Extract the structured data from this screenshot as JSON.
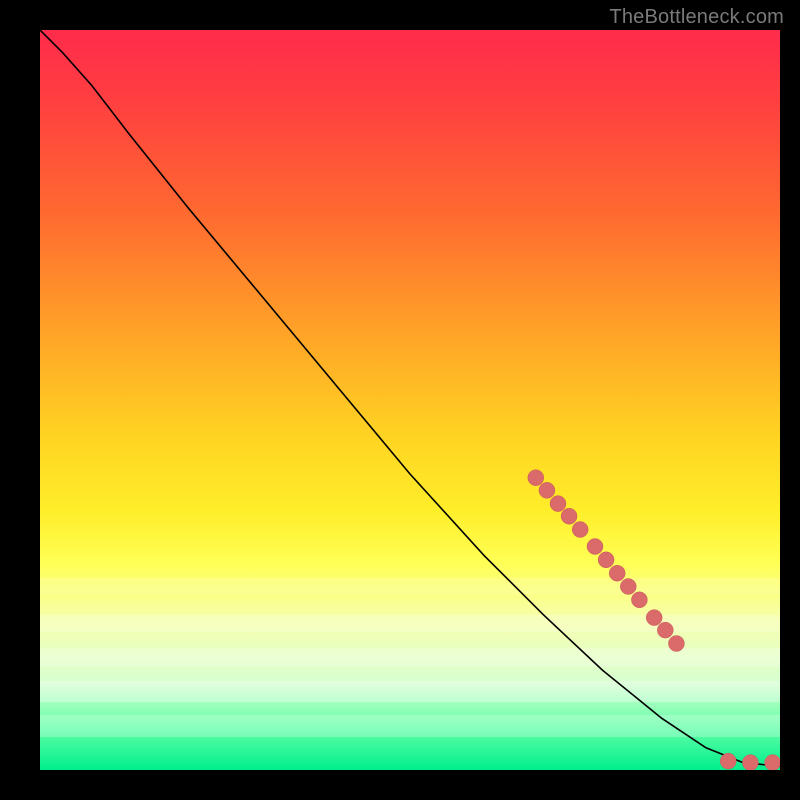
{
  "watermark": "TheBottleneck.com",
  "chart_data": {
    "type": "line",
    "title": "",
    "xlabel": "",
    "ylabel": "",
    "xlim": [
      0,
      100
    ],
    "ylim": [
      0,
      100
    ],
    "curve": [
      {
        "x": 0,
        "y": 100
      },
      {
        "x": 3,
        "y": 97
      },
      {
        "x": 7,
        "y": 92.5
      },
      {
        "x": 12,
        "y": 86
      },
      {
        "x": 20,
        "y": 76
      },
      {
        "x": 30,
        "y": 64
      },
      {
        "x": 40,
        "y": 52
      },
      {
        "x": 50,
        "y": 40
      },
      {
        "x": 60,
        "y": 29
      },
      {
        "x": 68,
        "y": 21
      },
      {
        "x": 76,
        "y": 13.5
      },
      {
        "x": 84,
        "y": 7
      },
      {
        "x": 90,
        "y": 3
      },
      {
        "x": 95,
        "y": 1
      },
      {
        "x": 100,
        "y": 0.5
      }
    ],
    "series": [
      {
        "name": "markers",
        "color": "#db6b6b",
        "points": [
          {
            "x": 67,
            "y": 39.5
          },
          {
            "x": 68.5,
            "y": 37.8
          },
          {
            "x": 70,
            "y": 36
          },
          {
            "x": 71.5,
            "y": 34.3
          },
          {
            "x": 73,
            "y": 32.5
          },
          {
            "x": 75,
            "y": 30.2
          },
          {
            "x": 76.5,
            "y": 28.4
          },
          {
            "x": 78,
            "y": 26.6
          },
          {
            "x": 79.5,
            "y": 24.8
          },
          {
            "x": 81,
            "y": 23
          },
          {
            "x": 83,
            "y": 20.6
          },
          {
            "x": 84.5,
            "y": 18.9
          },
          {
            "x": 86,
            "y": 17.1
          },
          {
            "x": 93,
            "y": 1.2
          },
          {
            "x": 96,
            "y": 1.0
          },
          {
            "x": 99,
            "y": 1.0
          }
        ]
      }
    ],
    "gradient_stops": [
      {
        "pos": 0,
        "color": "#ff2b4b"
      },
      {
        "pos": 55,
        "color": "#ffd422"
      },
      {
        "pos": 100,
        "color": "#00ef8c"
      }
    ]
  }
}
